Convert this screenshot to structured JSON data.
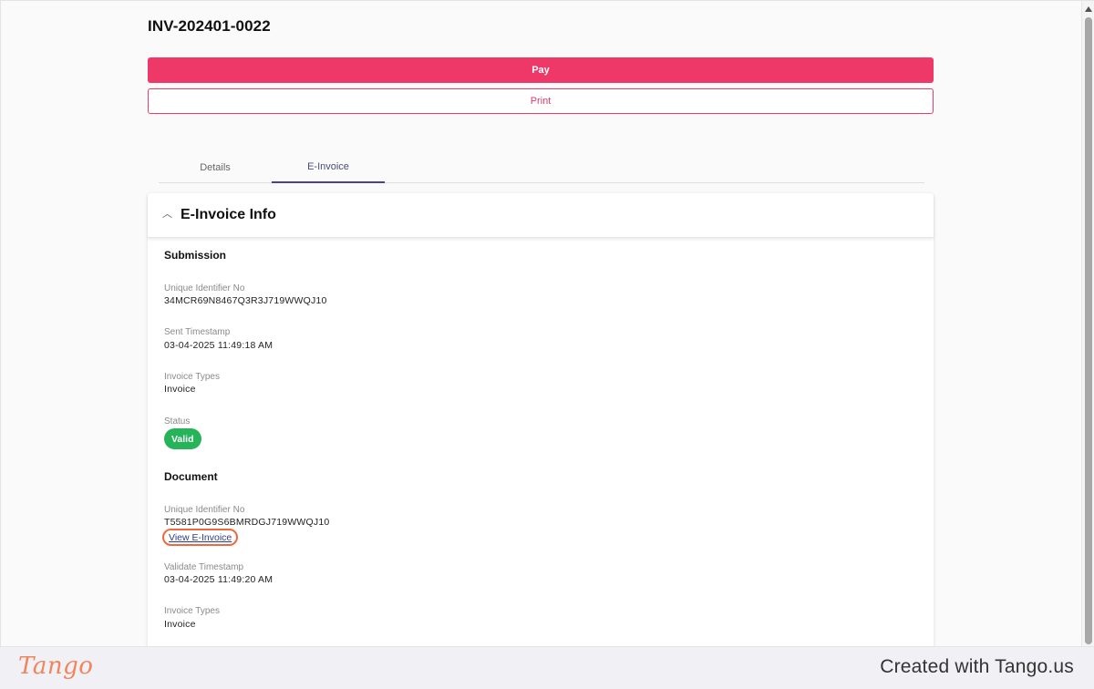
{
  "invoice": {
    "number": "INV-202401-0022"
  },
  "actions": {
    "pay_label": "Pay",
    "print_label": "Print"
  },
  "tabs": [
    {
      "label": "Details",
      "active": false
    },
    {
      "label": "E-Invoice",
      "active": true
    }
  ],
  "einvoice": {
    "title": "E-Invoice Info",
    "submission": {
      "title": "Submission",
      "uid_label": "Unique Identifier No",
      "uid_value": "34MCR69N8467Q3R3J719WWQJ10",
      "sent_label": "Sent Timestamp",
      "sent_value": "03-04-2025 11:49:18 AM",
      "types_label": "Invoice Types",
      "types_value": "Invoice",
      "status_label": "Status",
      "status_value": "Valid"
    },
    "document": {
      "title": "Document",
      "uid_label": "Unique Identifier No",
      "uid_value": "T5581P0G9S6BMRDGJ719WWQJ10",
      "view_link": "View E-Invoice",
      "validate_label": "Validate Timestamp",
      "validate_value": "03-04-2025 11:49:20 AM",
      "types_label": "Invoice Types",
      "types_value": "Invoice"
    }
  },
  "footer": {
    "logo": "Tango",
    "created_with": "Created with Tango.us"
  },
  "colors": {
    "primary": "#ee3868",
    "tab_active": "#4b3f8f",
    "status_valid": "#27b35a",
    "highlight": "#ef6a3a"
  }
}
